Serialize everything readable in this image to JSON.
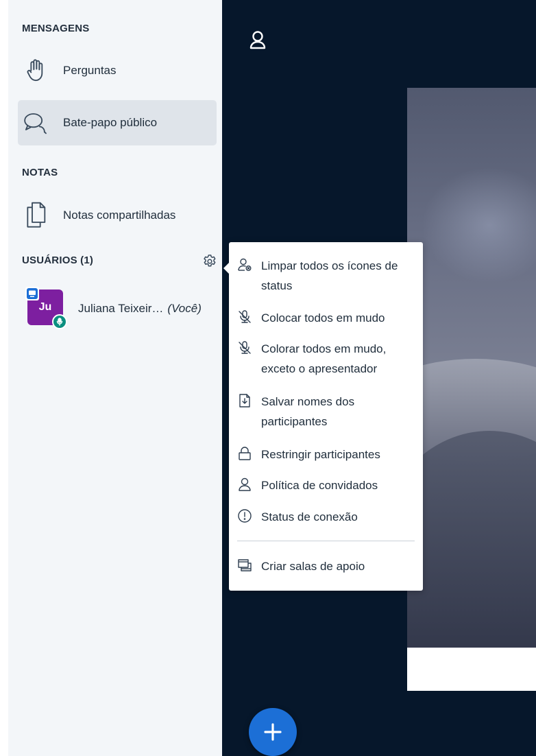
{
  "sidebar": {
    "messages_title": "MENSAGENS",
    "messages": [
      {
        "label": "Perguntas",
        "icon": "raised-hand-icon"
      },
      {
        "label": "Bate-papo público",
        "icon": "chat-icon"
      }
    ],
    "notes_title": "NOTAS",
    "notes": [
      {
        "label": "Notas compartilhadas",
        "icon": "shared-notes-icon"
      }
    ],
    "users_title": "USUÁRIOS (1)",
    "users": [
      {
        "initials": "Ju",
        "name": "Juliana Teixeir…",
        "self_tag": "(Você)",
        "avatar_color": "#7d1fa0",
        "status_color": "#0b8f80"
      }
    ]
  },
  "user_options_menu": {
    "items": [
      {
        "label": "Limpar todos os ícones de status",
        "icon": "clear-status-icon"
      },
      {
        "label": "Colocar todos em mudo",
        "icon": "mute-icon"
      },
      {
        "label": "Colorar todos em mudo, exceto o apresentador",
        "icon": "mute-icon"
      },
      {
        "label": "Salvar nomes dos participantes",
        "icon": "download-file-icon"
      },
      {
        "label": "Restringir participantes",
        "icon": "lock-icon"
      },
      {
        "label": "Política de convidados",
        "icon": "user-icon"
      },
      {
        "label": "Status de conexão",
        "icon": "alert-circle-icon"
      },
      {
        "label": "Criar salas de apoio",
        "icon": "breakout-rooms-icon"
      }
    ]
  },
  "colors": {
    "main_background": "#06172b",
    "action_button": "#1c6fd6",
    "active_nav": "#dfe4ea"
  }
}
